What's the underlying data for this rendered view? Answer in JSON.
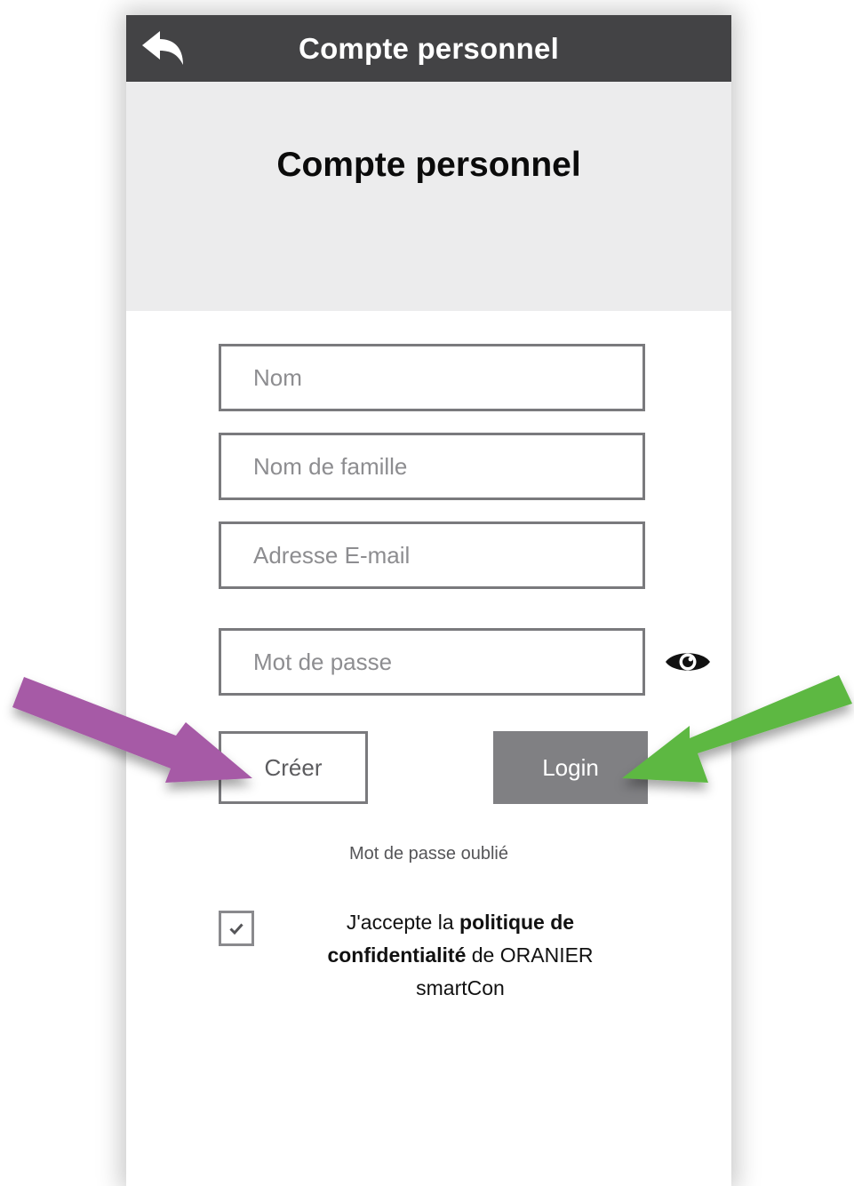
{
  "appbar": {
    "title": "Compte personnel",
    "back_icon": "back-arrow-icon"
  },
  "hero": {
    "title": "Compte personnel"
  },
  "form": {
    "first_name_placeholder": "Nom",
    "last_name_placeholder": "Nom de famille",
    "email_placeholder": "Adresse E-mail",
    "password_placeholder": "Mot de passe",
    "password_toggle_icon": "eye-icon",
    "create_label": "Créer",
    "login_label": "Login",
    "forgot_password": "Mot de passe oublié"
  },
  "consent": {
    "checked": true,
    "check_icon": "checkmark-icon",
    "text_before": "J'accepte la ",
    "link_text_1": "politique de",
    "link_text_2": "confidentialité",
    "text_after_1": " de ORANIER",
    "text_after_2": "smartCon"
  },
  "annotations": {
    "arrow_left_color": "#a65aa6",
    "arrow_right_color": "#5db843"
  },
  "colors": {
    "appbar": "#434345",
    "hero_bg": "#ececed",
    "field_border": "#7a7a7d",
    "login_bg": "#808083"
  }
}
